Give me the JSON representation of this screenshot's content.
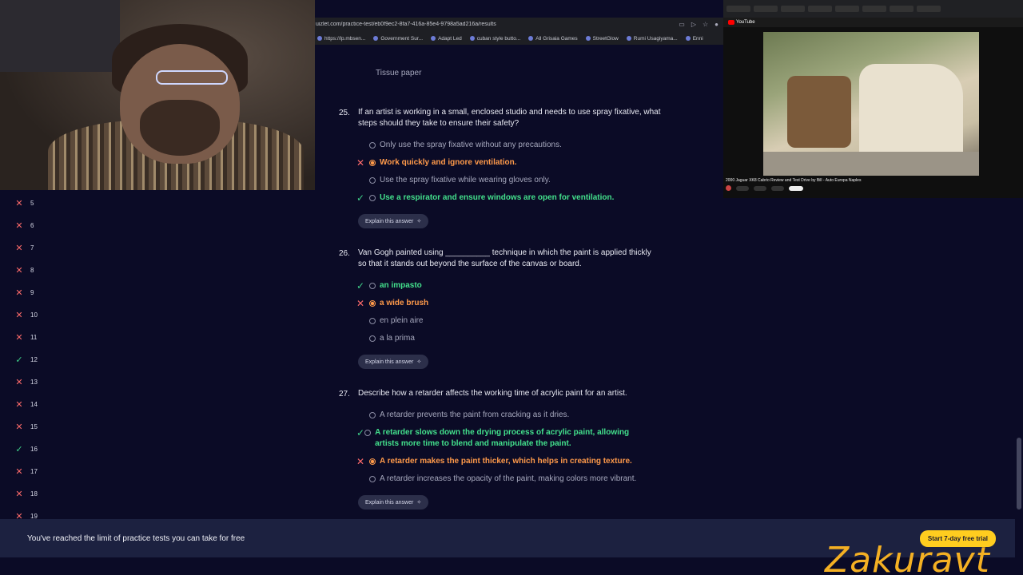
{
  "browser": {
    "url": "uizlet.com/practice-test/eb0f9ec2-8fa7-416a-85e4-9798a5ad216a/results",
    "bookmarks": [
      "https://lp.mbsen...",
      "Government Sur...",
      "Adapt Led",
      "cuban style butto...",
      "All Grisaia Games",
      "StreetGlow",
      "Rumi Usagiyama...",
      "Enni"
    ]
  },
  "pip": {
    "site": "YouTube",
    "video_title": "2000 Jaguar XK8 Cabrio Review and Test Drive by Bill - Auto Europa Naples"
  },
  "sidebar": {
    "items": [
      {
        "num": "5",
        "status": "wrong"
      },
      {
        "num": "6",
        "status": "wrong"
      },
      {
        "num": "7",
        "status": "wrong"
      },
      {
        "num": "8",
        "status": "wrong"
      },
      {
        "num": "9",
        "status": "wrong"
      },
      {
        "num": "10",
        "status": "wrong"
      },
      {
        "num": "11",
        "status": "wrong"
      },
      {
        "num": "12",
        "status": "right"
      },
      {
        "num": "13",
        "status": "wrong"
      },
      {
        "num": "14",
        "status": "wrong"
      },
      {
        "num": "15",
        "status": "wrong"
      },
      {
        "num": "16",
        "status": "right"
      },
      {
        "num": "17",
        "status": "wrong"
      },
      {
        "num": "18",
        "status": "wrong"
      },
      {
        "num": "19",
        "status": "wrong"
      }
    ]
  },
  "prev_option": "Tissue paper",
  "questions": [
    {
      "num": "25.",
      "prompt": "If an artist is working in a small, enclosed studio and needs to use spray fixative, what steps should they take to ensure their safety?",
      "options": [
        {
          "text": "Only use the spray fixative without any precautions.",
          "state": "normal"
        },
        {
          "text": "Work quickly and ignore ventilation.",
          "state": "wrong"
        },
        {
          "text": "Use the spray fixative while wearing gloves only.",
          "state": "normal"
        },
        {
          "text": "Use a respirator and ensure windows are open for ventilation.",
          "state": "right"
        }
      ],
      "explain": "Explain this answer"
    },
    {
      "num": "26.",
      "prompt": "Van Gogh painted using __________ technique in which the paint is applied thickly so that it stands out beyond the surface of the canvas or board.",
      "options": [
        {
          "text": "an impasto",
          "state": "right"
        },
        {
          "text": "a wide brush",
          "state": "wrong"
        },
        {
          "text": "en plein aire",
          "state": "normal"
        },
        {
          "text": "a la prima",
          "state": "normal"
        }
      ],
      "explain": "Explain this answer"
    },
    {
      "num": "27.",
      "prompt": "Describe how a retarder affects the working time of acrylic paint for an artist.",
      "options": [
        {
          "text": "A retarder prevents the paint from cracking as it dries.",
          "state": "normal"
        },
        {
          "text": "A retarder slows down the drying process of acrylic paint, allowing artists more time to blend and manipulate the paint.",
          "state": "right"
        },
        {
          "text": "A retarder makes the paint thicker, which helps in creating texture.",
          "state": "wrong"
        },
        {
          "text": "A retarder increases the opacity of the paint, making colors more vibrant.",
          "state": "normal"
        }
      ],
      "explain": "Explain this answer"
    }
  ],
  "footer": {
    "message": "You've reached the limit of practice tests you can take for free",
    "cta": "Start 7-day free trial"
  },
  "watermark": "Zakuravt",
  "colors": {
    "wrong": "#ff9a4a",
    "right": "#43e08c",
    "cta": "#ffcd1f",
    "bg": "#0b0b26"
  }
}
